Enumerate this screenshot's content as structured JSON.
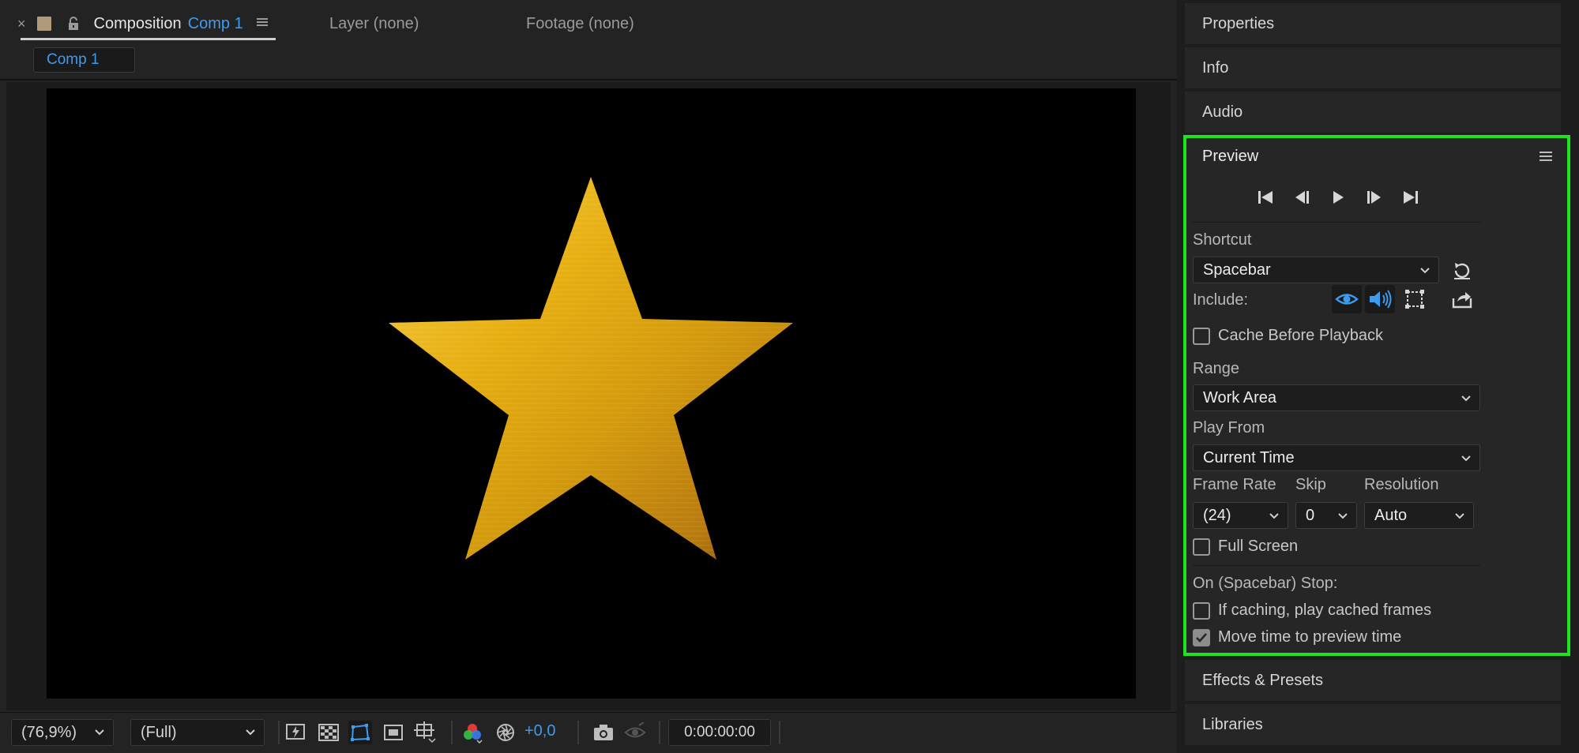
{
  "composition_panel": {
    "tabs": {
      "composition": {
        "close_glyph": "×",
        "title": "Composition",
        "name": "Comp 1",
        "menu_glyph": "≡"
      },
      "layer": "Layer (none)",
      "footage": "Footage (none)"
    },
    "subtab": "Comp 1",
    "bottom_bar": {
      "zoom": "(76,9%)",
      "resolution": "(Full)",
      "exposure": "+0,0",
      "timecode": "0:00:00:00"
    }
  },
  "right_panels": {
    "properties": "Properties",
    "info": "Info",
    "audio": "Audio",
    "effects_presets": "Effects & Presets",
    "libraries": "Libraries"
  },
  "preview": {
    "title": "Preview",
    "shortcut_label": "Shortcut",
    "shortcut_value": "Spacebar",
    "include_label": "Include:",
    "cache_before_playback": {
      "label": "Cache Before Playback",
      "checked": false
    },
    "range_label": "Range",
    "range_value": "Work Area",
    "play_from_label": "Play From",
    "play_from_value": "Current Time",
    "frame_rate_label": "Frame Rate",
    "frame_rate_value": "(24)",
    "skip_label": "Skip",
    "skip_value": "0",
    "resolution_label": "Resolution",
    "resolution_value": "Auto",
    "full_screen": {
      "label": "Full Screen",
      "checked": false
    },
    "on_stop_label": "On (Spacebar) Stop:",
    "if_caching": {
      "label": "If caching, play cached frames",
      "checked": false
    },
    "move_time": {
      "label": "Move time to preview time",
      "checked": true
    }
  },
  "colors": {
    "accent_blue": "#3d9cf0",
    "highlight_green": "#1fe31f",
    "star_gold": "#e0a80f"
  }
}
